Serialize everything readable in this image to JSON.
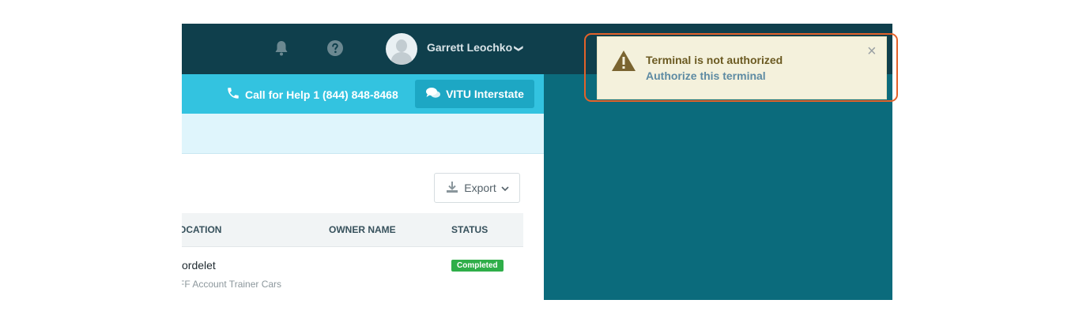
{
  "topbar": {
    "bell_icon": "bell-icon",
    "help_icon": "question-circle-icon",
    "user_name": "Garrett Leochko",
    "user_chevron": "❯"
  },
  "helpbar": {
    "call_label": "Call for Help 1 (844) 848-8468",
    "chat_label": "VITU Interstate"
  },
  "toolbar": {
    "export_label": "Export"
  },
  "table": {
    "columns": [
      "OCATION",
      "OWNER NAME",
      "STATUS"
    ],
    "rows": [
      {
        "name": "ordelet",
        "sub": "FF Account Trainer Cars",
        "status": "Completed"
      }
    ]
  },
  "toast": {
    "title": "Terminal is not authorized",
    "link": "Authorize this terminal",
    "close": "×"
  },
  "colors": {
    "topbar": "#0f3f4c",
    "helpbar": "#33c3e0",
    "background": "#0b6b7c",
    "toast_bg": "#f4f1dc",
    "highlight": "#e3622a",
    "status_completed": "#2fae49"
  }
}
